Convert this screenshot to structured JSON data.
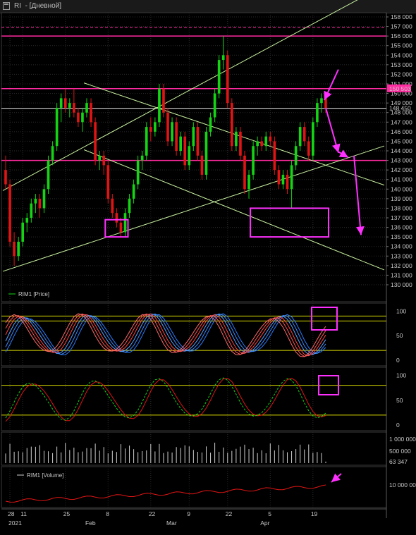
{
  "window": {
    "title_symbol": "RI",
    "title_period": "- [Дневной]"
  },
  "colors": {
    "background": "#000000",
    "grid": "#2b2b2b",
    "up_candle": "#14d414",
    "down_candle": "#e01414",
    "trendline": "#c8f0a0",
    "level_magenta": "#ff2aa0",
    "annotation": "#ff30ff",
    "last_price": "#32e632",
    "stoch_level": "#d8d800"
  },
  "chart_data": [
    {
      "type": "candlestick",
      "legend": "RIM1 [Price]",
      "y_ticks": [
        "158 000",
        "157 000",
        "156 000",
        "155 000",
        "154 000",
        "153 000",
        "152 000",
        "151 000",
        "150 000",
        "149 000",
        "148 000",
        "147 000",
        "146 000",
        "145 000",
        "144 000",
        "143 000",
        "142 000",
        "141 000",
        "140 000",
        "139 000",
        "138 000",
        "137 000",
        "136 000",
        "135 000",
        "134 000",
        "133 000",
        "132 000",
        "131 000",
        "130 000"
      ],
      "ylim": [
        130000,
        158000
      ],
      "highlight_price_label": "150 503",
      "last_price_label": "148 450",
      "horizontal_levels": [
        156000,
        150500,
        143000
      ],
      "dashed_level": 156900,
      "last_price": 148450,
      "candles": [
        {
          "date": "2021-01-04",
          "o": 142000,
          "h": 143500,
          "l": 140000,
          "c": 140500
        },
        {
          "date": "2021-01-05",
          "o": 140500,
          "h": 141000,
          "l": 134000,
          "c": 134500
        },
        {
          "date": "2021-01-06",
          "o": 134500,
          "h": 135500,
          "l": 132000,
          "c": 133000
        },
        {
          "date": "2021-01-08",
          "o": 133000,
          "h": 135000,
          "l": 132500,
          "c": 134500
        },
        {
          "date": "2021-01-11",
          "o": 134500,
          "h": 137000,
          "l": 134000,
          "c": 136500
        },
        {
          "date": "2021-01-12",
          "o": 136500,
          "h": 137500,
          "l": 135500,
          "c": 137000
        },
        {
          "date": "2021-01-13",
          "o": 137000,
          "h": 139000,
          "l": 136500,
          "c": 138500
        },
        {
          "date": "2021-01-14",
          "o": 138500,
          "h": 139500,
          "l": 137500,
          "c": 139000
        },
        {
          "date": "2021-01-15",
          "o": 139000,
          "h": 139500,
          "l": 137000,
          "c": 138000
        },
        {
          "date": "2021-01-18",
          "o": 138000,
          "h": 140500,
          "l": 137500,
          "c": 140000
        },
        {
          "date": "2021-01-19",
          "o": 140000,
          "h": 143500,
          "l": 139500,
          "c": 143000
        },
        {
          "date": "2021-01-20",
          "o": 143000,
          "h": 145000,
          "l": 142500,
          "c": 144500
        },
        {
          "date": "2021-01-21",
          "o": 144500,
          "h": 149000,
          "l": 144000,
          "c": 148500
        },
        {
          "date": "2021-01-22",
          "o": 148500,
          "h": 150000,
          "l": 147000,
          "c": 149500
        },
        {
          "date": "2021-01-25",
          "o": 149500,
          "h": 150500,
          "l": 148000,
          "c": 148500
        },
        {
          "date": "2021-01-26",
          "o": 148500,
          "h": 149500,
          "l": 147500,
          "c": 149000
        },
        {
          "date": "2021-01-27",
          "o": 149000,
          "h": 150500,
          "l": 147500,
          "c": 148000
        },
        {
          "date": "2021-01-28",
          "o": 148000,
          "h": 148500,
          "l": 146500,
          "c": 147000
        },
        {
          "date": "2021-01-29",
          "o": 147000,
          "h": 148500,
          "l": 146000,
          "c": 148000
        },
        {
          "date": "2021-02-01",
          "o": 148000,
          "h": 149500,
          "l": 147500,
          "c": 149000
        },
        {
          "date": "2021-02-02",
          "o": 149000,
          "h": 149500,
          "l": 146500,
          "c": 147000
        },
        {
          "date": "2021-02-03",
          "o": 147000,
          "h": 147500,
          "l": 142500,
          "c": 143000
        },
        {
          "date": "2021-02-04",
          "o": 143000,
          "h": 144000,
          "l": 142000,
          "c": 143500
        },
        {
          "date": "2021-02-05",
          "o": 143500,
          "h": 144000,
          "l": 141500,
          "c": 142500
        },
        {
          "date": "2021-02-08",
          "o": 142500,
          "h": 143000,
          "l": 138500,
          "c": 139000
        },
        {
          "date": "2021-02-09",
          "o": 139000,
          "h": 139500,
          "l": 137000,
          "c": 137500
        },
        {
          "date": "2021-02-10",
          "o": 137500,
          "h": 138000,
          "l": 136000,
          "c": 136500
        },
        {
          "date": "2021-02-11",
          "o": 136500,
          "h": 137000,
          "l": 135000,
          "c": 135500
        },
        {
          "date": "2021-02-12",
          "o": 135500,
          "h": 138000,
          "l": 135000,
          "c": 137500
        },
        {
          "date": "2021-02-15",
          "o": 137500,
          "h": 139500,
          "l": 137000,
          "c": 139000
        },
        {
          "date": "2021-02-16",
          "o": 139000,
          "h": 141000,
          "l": 138500,
          "c": 140500
        },
        {
          "date": "2021-02-17",
          "o": 140500,
          "h": 143500,
          "l": 140000,
          "c": 143000
        },
        {
          "date": "2021-02-18",
          "o": 143000,
          "h": 144000,
          "l": 142000,
          "c": 143500
        },
        {
          "date": "2021-02-19",
          "o": 143500,
          "h": 147000,
          "l": 143000,
          "c": 146500
        },
        {
          "date": "2021-02-22",
          "o": 146500,
          "h": 147500,
          "l": 145000,
          "c": 146000
        },
        {
          "date": "2021-02-24",
          "o": 146000,
          "h": 147500,
          "l": 145500,
          "c": 147000
        },
        {
          "date": "2021-02-25",
          "o": 147000,
          "h": 151000,
          "l": 146500,
          "c": 150500
        },
        {
          "date": "2021-02-26",
          "o": 150500,
          "h": 151000,
          "l": 147500,
          "c": 148000
        },
        {
          "date": "2021-03-01",
          "o": 148000,
          "h": 148500,
          "l": 144500,
          "c": 145000
        },
        {
          "date": "2021-03-02",
          "o": 145000,
          "h": 147500,
          "l": 144500,
          "c": 147000
        },
        {
          "date": "2021-03-03",
          "o": 147000,
          "h": 147500,
          "l": 143500,
          "c": 144000
        },
        {
          "date": "2021-03-04",
          "o": 144000,
          "h": 146000,
          "l": 143500,
          "c": 145500
        },
        {
          "date": "2021-03-05",
          "o": 145500,
          "h": 146000,
          "l": 142000,
          "c": 142500
        },
        {
          "date": "2021-03-09",
          "o": 142500,
          "h": 145000,
          "l": 142000,
          "c": 144500
        },
        {
          "date": "2021-03-10",
          "o": 144500,
          "h": 147000,
          "l": 144000,
          "c": 146500
        },
        {
          "date": "2021-03-11",
          "o": 146500,
          "h": 147000,
          "l": 143000,
          "c": 143500
        },
        {
          "date": "2021-03-12",
          "o": 143500,
          "h": 144000,
          "l": 141000,
          "c": 141500
        },
        {
          "date": "2021-03-15",
          "o": 141500,
          "h": 146500,
          "l": 141000,
          "c": 146000
        },
        {
          "date": "2021-03-16",
          "o": 146000,
          "h": 148000,
          "l": 145500,
          "c": 147500
        },
        {
          "date": "2021-03-17",
          "o": 147500,
          "h": 150500,
          "l": 147000,
          "c": 150000
        },
        {
          "date": "2021-03-18",
          "o": 150000,
          "h": 154000,
          "l": 149500,
          "c": 153500
        },
        {
          "date": "2021-03-19",
          "o": 153500,
          "h": 156000,
          "l": 152500,
          "c": 154000
        },
        {
          "date": "2021-03-22",
          "o": 154000,
          "h": 154500,
          "l": 148500,
          "c": 149000
        },
        {
          "date": "2021-03-23",
          "o": 149000,
          "h": 149500,
          "l": 144000,
          "c": 144500
        },
        {
          "date": "2021-03-24",
          "o": 144500,
          "h": 146500,
          "l": 144000,
          "c": 146000
        },
        {
          "date": "2021-03-25",
          "o": 146000,
          "h": 146500,
          "l": 143000,
          "c": 143500
        },
        {
          "date": "2021-03-26",
          "o": 143500,
          "h": 144000,
          "l": 139500,
          "c": 140000
        },
        {
          "date": "2021-03-29",
          "o": 140000,
          "h": 142000,
          "l": 139000,
          "c": 141500
        },
        {
          "date": "2021-03-30",
          "o": 141500,
          "h": 145000,
          "l": 141000,
          "c": 144500
        },
        {
          "date": "2021-03-31",
          "o": 144500,
          "h": 145500,
          "l": 143500,
          "c": 145000
        },
        {
          "date": "2021-04-01",
          "o": 145000,
          "h": 145500,
          "l": 144000,
          "c": 144500
        },
        {
          "date": "2021-04-02",
          "o": 144500,
          "h": 146000,
          "l": 144000,
          "c": 145500
        },
        {
          "date": "2021-04-05",
          "o": 145500,
          "h": 146000,
          "l": 144500,
          "c": 145000
        },
        {
          "date": "2021-04-06",
          "o": 145000,
          "h": 145500,
          "l": 141500,
          "c": 142000
        },
        {
          "date": "2021-04-07",
          "o": 142000,
          "h": 142500,
          "l": 140000,
          "c": 140500
        },
        {
          "date": "2021-04-08",
          "o": 140500,
          "h": 142000,
          "l": 140000,
          "c": 141500
        },
        {
          "date": "2021-04-09",
          "o": 141500,
          "h": 142000,
          "l": 139500,
          "c": 140000
        },
        {
          "date": "2021-04-12",
          "o": 140000,
          "h": 143000,
          "l": 138000,
          "c": 142500
        },
        {
          "date": "2021-04-13",
          "o": 142500,
          "h": 145000,
          "l": 142000,
          "c": 144500
        },
        {
          "date": "2021-04-14",
          "o": 144500,
          "h": 147000,
          "l": 144000,
          "c": 146500
        },
        {
          "date": "2021-04-15",
          "o": 146500,
          "h": 147000,
          "l": 144500,
          "c": 145000
        },
        {
          "date": "2021-04-16",
          "o": 145000,
          "h": 145500,
          "l": 143000,
          "c": 143500
        },
        {
          "date": "2021-04-19",
          "o": 143500,
          "h": 147500,
          "l": 143000,
          "c": 147000
        },
        {
          "date": "2021-04-20",
          "o": 147000,
          "h": 149500,
          "l": 146500,
          "c": 149000
        },
        {
          "date": "2021-04-21",
          "o": 149000,
          "h": 150000,
          "l": 148000,
          "c": 149500
        },
        {
          "date": "2021-04-22",
          "o": 149500,
          "h": 150000,
          "l": 148000,
          "c": 148450
        }
      ],
      "trendlines": [
        {
          "from": [
            "2021-01-04",
            140000
          ],
          "to": [
            "2021-04-22",
            158000
          ]
        },
        {
          "from": [
            "2021-01-04",
            131500
          ],
          "to": [
            "2021-04-22",
            142500
          ]
        },
        {
          "from": [
            "2021-02-01",
            151000
          ],
          "to": [
            "2021-04-22",
            142500
          ]
        },
        {
          "from": [
            "2021-02-01",
            144000
          ],
          "to": [
            "2021-04-22",
            134000
          ]
        }
      ],
      "annotation_boxes": [
        {
          "x": [
            "2021-02-08",
            "2021-02-12"
          ],
          "y": [
            135000,
            136800
          ]
        },
        {
          "x": [
            "2021-03-30",
            "2021-04-22"
          ],
          "y": [
            135000,
            138000
          ]
        }
      ],
      "annotation_arrows": [
        {
          "from": [
            "2021-04-20",
            152500
          ],
          "to": [
            "2021-04-21",
            149300
          ]
        },
        {
          "from": [
            "2021-04-21",
            148500
          ],
          "to": [
            "2021-04-22",
            143800
          ]
        },
        {
          "from": [
            "2021-04-22",
            143900
          ],
          "to": [
            "2021-04-22",
            143300
          ]
        },
        {
          "from": [
            "2021-04-22",
            143500
          ],
          "to": [
            "2021-04-22",
            135200
          ]
        }
      ]
    },
    {
      "type": "line",
      "y_ticks": [
        "100",
        "50",
        "0"
      ],
      "ylim": [
        0,
        105
      ],
      "levels": [
        80,
        20
      ],
      "series_style": "stochastic_ribbon"
    },
    {
      "type": "line",
      "y_ticks": [
        "100",
        "50",
        "0"
      ],
      "ylim": [
        0,
        105
      ],
      "levels": [
        80,
        20
      ]
    },
    {
      "type": "bar",
      "y_ticks": [
        "1 000 000",
        "500 000",
        "63 347"
      ],
      "ylim": [
        0,
        1200000
      ],
      "last_value_label": "63 347"
    },
    {
      "type": "line",
      "legend": "RIM1 [Volume]",
      "y_ticks": [
        "10 000 000"
      ]
    }
  ],
  "time_axis": {
    "labels": [
      {
        "date": "2021-01-05",
        "text": "28"
      },
      {
        "date": "2021-01-11",
        "text": "11"
      },
      {
        "date": "2021-01-25",
        "text": "25"
      },
      {
        "date": "2021-02-08",
        "text": "8"
      },
      {
        "date": "2021-02-22",
        "text": "22"
      },
      {
        "date": "2021-03-09",
        "text": "9"
      },
      {
        "date": "2021-03-22",
        "text": "22"
      },
      {
        "date": "2021-04-05",
        "text": "5"
      },
      {
        "date": "2021-04-19",
        "text": "19"
      }
    ],
    "sub_labels": [
      {
        "date": "2021-01-05",
        "text": "2021"
      },
      {
        "date": "2021-02-01",
        "text": "Feb"
      },
      {
        "date": "2021-03-01",
        "text": "Mar"
      },
      {
        "date": "2021-04-01",
        "text": "Apr"
      }
    ]
  }
}
